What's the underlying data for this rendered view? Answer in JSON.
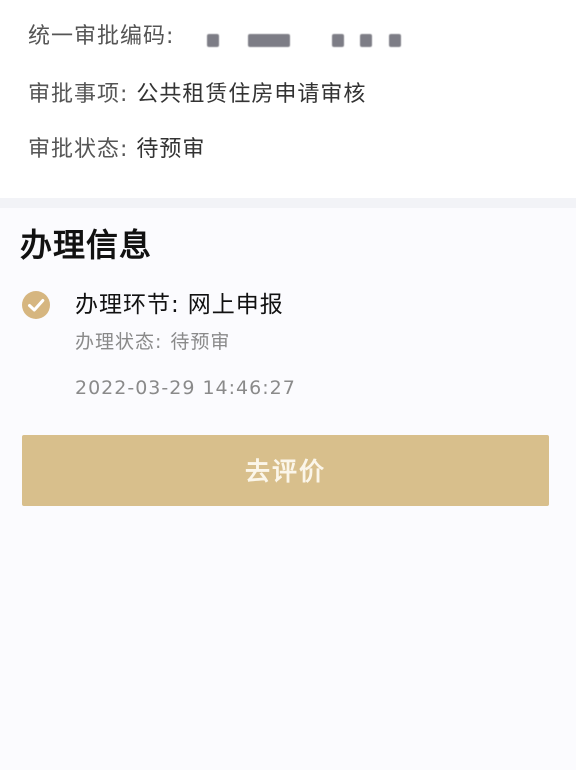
{
  "approval": {
    "code_label": "统一审批编码:",
    "item_label": "审批事项:",
    "item_value": "公共租赁住房申请审核",
    "status_label": "审批状态:",
    "status_value": "待预审"
  },
  "processing": {
    "section_title": "办理信息",
    "step_label": "办理环节:",
    "step_value": "网上申报",
    "status_label": "办理状态:",
    "status_value": "待预审",
    "timestamp": "2022-03-29 14:46:27",
    "check_icon": "check-circle-icon"
  },
  "actions": {
    "evaluate_label": "去评价"
  },
  "colors": {
    "accent": "#d8bf8c",
    "check": "#d6b680",
    "background": "#f6f7fb"
  }
}
